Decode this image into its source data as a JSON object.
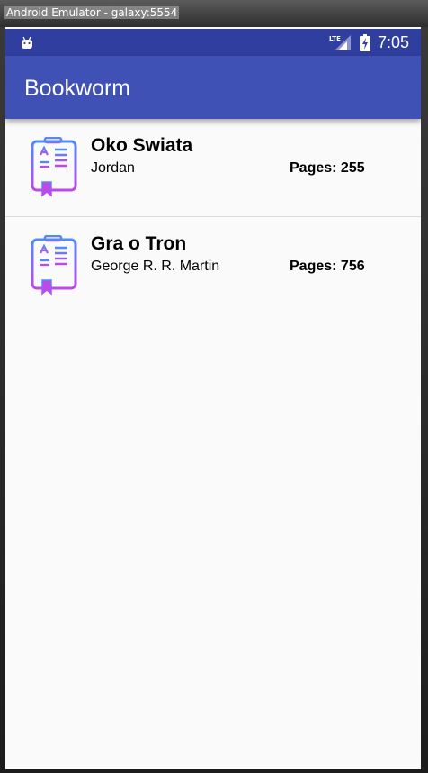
{
  "window": {
    "title": "Android Emulator - galaxy:5554"
  },
  "status_bar": {
    "network": "LTE",
    "time": "7:05",
    "icons": [
      "android-icon",
      "lte-signal-icon",
      "battery-charging-icon"
    ]
  },
  "app_bar": {
    "title": "Bookworm"
  },
  "books": [
    {
      "title": "Oko Swiata",
      "author": "Jordan",
      "pages": "Pages: 255",
      "icon": "book-icon"
    },
    {
      "title": "Gra o Tron",
      "author": "George R. R. Martin",
      "pages": "Pages: 756",
      "icon": "book-icon"
    }
  ],
  "colors": {
    "status_bar": "#303f9f",
    "app_bar": "#3f51b5",
    "icon_gradient_start": "#4f8df5",
    "icon_gradient_end": "#c048e8",
    "background": "#fafafa"
  }
}
